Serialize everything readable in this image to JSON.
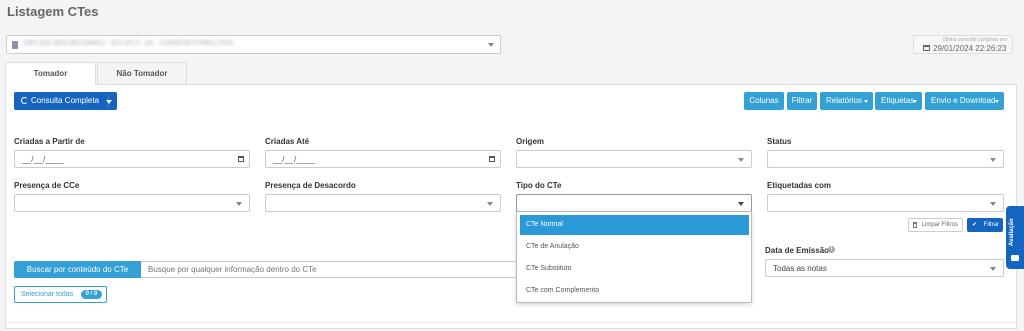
{
  "page_title": "Listagem CTes",
  "company_select": {
    "value": "(SP) (DO BOLDECOMAV) - ECI (F) C. (A) - CONSTRUTORA LTDA"
  },
  "last_query": {
    "label": "Última consulta completa em:",
    "datetime": "29/01/2024 22:26:23"
  },
  "tabs": [
    {
      "label": "Tomador",
      "active": true
    },
    {
      "label": "Não Tomador",
      "active": false
    }
  ],
  "toolbar": {
    "consulta_label": "Consulta Completa",
    "buttons": [
      "Colunas",
      "Filtrar",
      "Relatórios",
      "Etiquetas",
      "Envio e Download"
    ]
  },
  "filters": {
    "criadas_partir": {
      "label": "Criadas a Partir de",
      "placeholder": "__/__/____"
    },
    "criadas_ate": {
      "label": "Criadas Até",
      "placeholder": "__/__/____"
    },
    "origem": {
      "label": "Origem"
    },
    "status": {
      "label": "Status"
    },
    "presenca_cce": {
      "label": "Presença de CCe"
    },
    "presenca_desacordo": {
      "label": "Presença de Desacordo"
    },
    "tipo_cte": {
      "label": "Tipo do CTe",
      "options": [
        "CTe Normal",
        "CTe de Anulação",
        "CTe Substituto",
        "CTe com Complemento"
      ],
      "highlighted": "CTe Normal"
    },
    "etiquetadas_com": {
      "label": "Etiquetadas com"
    },
    "data_emissao": {
      "label": "Data de Emissão",
      "value": "Todas as notas"
    }
  },
  "actions": {
    "limpar": "Limpar Filtros",
    "filtrar": "Filtrar"
  },
  "search": {
    "addon_label": "Buscar por conteúdo do CTe",
    "placeholder": "Busque por qualquer informação dentro do CTe"
  },
  "select_all": {
    "label": "Selecionar todas",
    "count": "0 / 0"
  },
  "feedback": {
    "label": "Avaliação"
  },
  "colors": {
    "primary": "#1565c0",
    "info": "#33a0d6",
    "highlight": "#2b98d8"
  }
}
